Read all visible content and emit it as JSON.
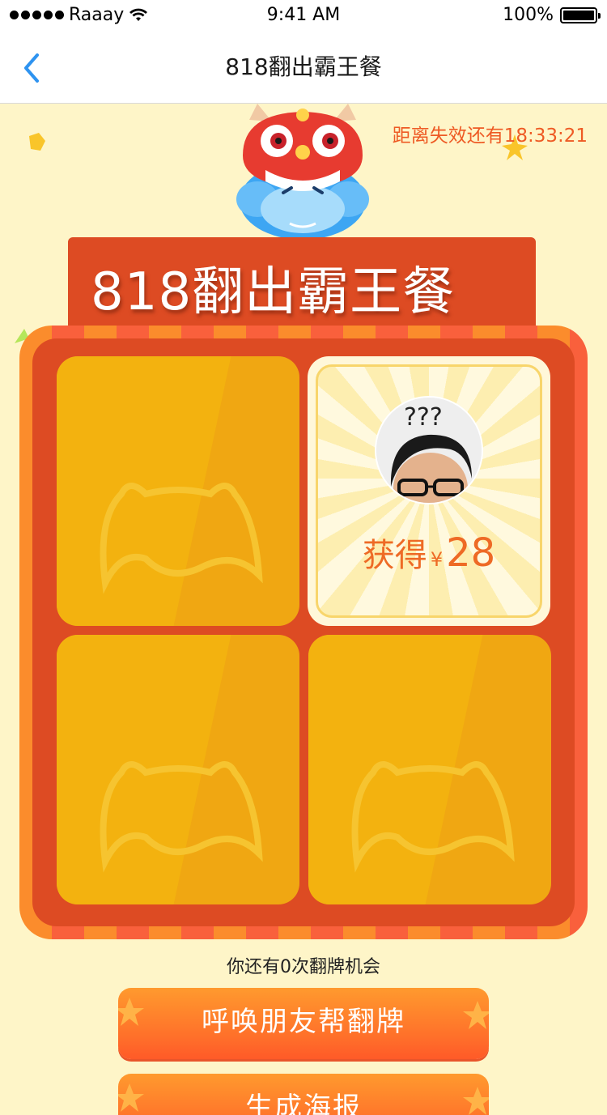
{
  "status_bar": {
    "carrier": "Raaay",
    "time": "9:41 AM",
    "battery": "100%"
  },
  "nav": {
    "title": "818翻出霸王餐"
  },
  "countdown": "距离失效还有18:33:21",
  "banner": {
    "title": "818翻出霸王餐"
  },
  "prize": {
    "label": "获得",
    "currency": "¥",
    "amount": "28"
  },
  "chances_text": "你还有0次翻牌机会",
  "buttons": {
    "call_friends": "呼唤朋友帮翻牌",
    "poster": "生成海报"
  },
  "colors": {
    "accent": "#dd4b23",
    "nav_back": "#2e93f0",
    "countdown": "#ee5a24",
    "card": "#f0a712"
  }
}
